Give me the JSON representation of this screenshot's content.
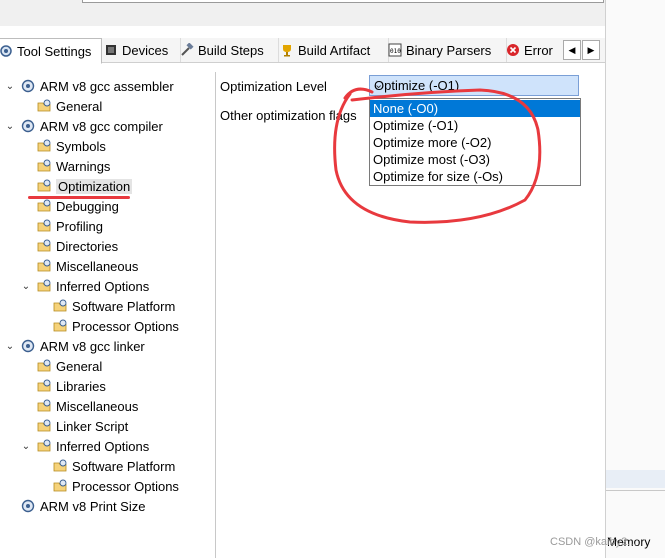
{
  "tabs": [
    {
      "label": "Tool Settings",
      "icon": "gear-icon",
      "active": true
    },
    {
      "label": "Devices",
      "icon": "chip-icon"
    },
    {
      "label": "Build Steps",
      "icon": "hammer-icon"
    },
    {
      "label": "Build Artifact",
      "icon": "trophy-icon"
    },
    {
      "label": "Binary Parsers",
      "icon": "binary-icon"
    },
    {
      "label": "Error",
      "icon": "error-icon"
    }
  ],
  "nav": {
    "left": "◀",
    "right": "▶"
  },
  "tree": [
    {
      "label": "ARM v8 gcc assembler",
      "level": 0,
      "expanded": true
    },
    {
      "label": "General",
      "level": 1
    },
    {
      "label": "ARM v8 gcc compiler",
      "level": 0,
      "expanded": true
    },
    {
      "label": "Symbols",
      "level": 1
    },
    {
      "label": "Warnings",
      "level": 1
    },
    {
      "label": "Optimization",
      "level": 1,
      "selected": true
    },
    {
      "label": "Debugging",
      "level": 1
    },
    {
      "label": "Profiling",
      "level": 1
    },
    {
      "label": "Directories",
      "level": 1
    },
    {
      "label": "Miscellaneous",
      "level": 1
    },
    {
      "label": "Inferred Options",
      "level": 1,
      "expanded": true
    },
    {
      "label": "Software Platform",
      "level": 2
    },
    {
      "label": "Processor Options",
      "level": 2
    },
    {
      "label": "ARM v8 gcc linker",
      "level": 0,
      "expanded": true
    },
    {
      "label": "General",
      "level": 1
    },
    {
      "label": "Libraries",
      "level": 1
    },
    {
      "label": "Miscellaneous",
      "level": 1
    },
    {
      "label": "Linker Script",
      "level": 1
    },
    {
      "label": "Inferred Options",
      "level": 1,
      "expanded": true
    },
    {
      "label": "Software Platform",
      "level": 2
    },
    {
      "label": "Processor Options",
      "level": 2
    },
    {
      "label": "ARM v8 Print Size",
      "level": 0
    }
  ],
  "main": {
    "optimization_level_label": "Optimization Level",
    "optimization_level_value": "Optimize (-O1)",
    "other_flags_label": "Other optimization flags",
    "options": [
      {
        "label": "None (-O0)",
        "highlighted": true
      },
      {
        "label": "Optimize (-O1)"
      },
      {
        "label": "Optimize more (-O2)"
      },
      {
        "label": "Optimize most (-O3)"
      },
      {
        "label": "Optimize for size (-Os)"
      }
    ]
  },
  "side": {
    "memory_label": "Memory"
  },
  "watermark": "CSDN @kaiby2...",
  "colors": {
    "highlight": "#0078d7",
    "annotation": "#e8393e",
    "combo_bg": "#cfe3fb"
  }
}
